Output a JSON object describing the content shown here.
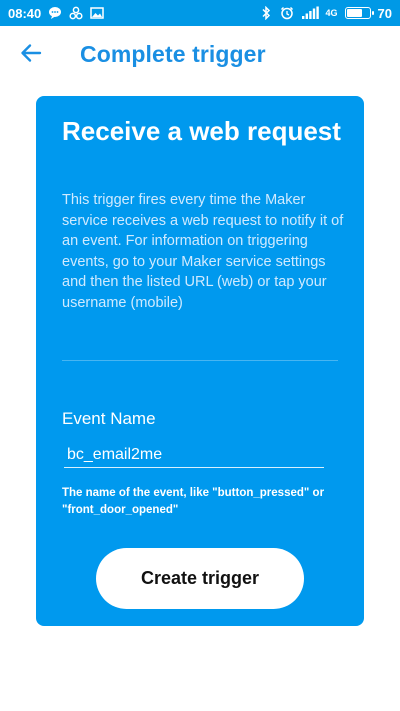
{
  "status_bar": {
    "time": "08:40",
    "left_icons": [
      "chat-bubble-icon",
      "app-icon",
      "image-icon"
    ],
    "right_icons": [
      "bluetooth-icon",
      "alarm-icon",
      "signal-icon",
      "4g-lte-icon"
    ],
    "network_label": "4G",
    "battery_level": 0.7,
    "battery_text": "70"
  },
  "header": {
    "back_icon": "arrow-left-icon",
    "title": "Complete trigger"
  },
  "card": {
    "title": "Receive a web request",
    "description": "This trigger fires every time the Maker service receives a web request to notify it of an event. For information on triggering events, go to your Maker service settings and then the listed URL (web) or tap your username (mobile)",
    "field_label": "Event Name",
    "field_value": "bc_email2me",
    "field_help": "The name of the event, like \"button_pressed\" or \"front_door_opened\"",
    "button_label": "Create trigger"
  },
  "colors": {
    "status_bar": "#0099e6",
    "card_background": "#0099ee",
    "title_accent": "#1a8fe3",
    "button_background": "#ffffff"
  }
}
